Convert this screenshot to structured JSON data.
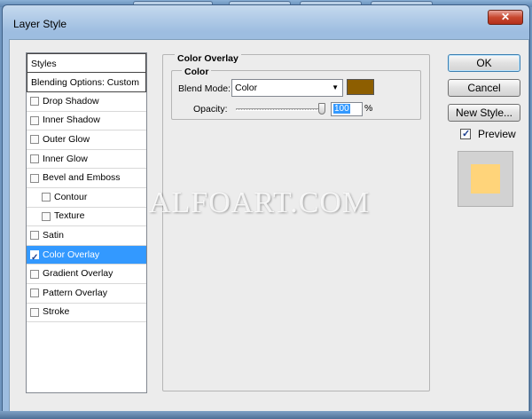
{
  "window": {
    "title": "Layer Style",
    "close_label": "✕"
  },
  "styles_panel": {
    "header": "Styles",
    "blending": "Blending Options: Custom",
    "items": [
      {
        "label": "Drop Shadow",
        "checked": false,
        "indent": false,
        "selected": false
      },
      {
        "label": "Inner Shadow",
        "checked": false,
        "indent": false,
        "selected": false
      },
      {
        "label": "Outer Glow",
        "checked": false,
        "indent": false,
        "selected": false
      },
      {
        "label": "Inner Glow",
        "checked": false,
        "indent": false,
        "selected": false
      },
      {
        "label": "Bevel and Emboss",
        "checked": false,
        "indent": false,
        "selected": false
      },
      {
        "label": "Contour",
        "checked": false,
        "indent": true,
        "selected": false
      },
      {
        "label": "Texture",
        "checked": false,
        "indent": true,
        "selected": false
      },
      {
        "label": "Satin",
        "checked": false,
        "indent": false,
        "selected": false
      },
      {
        "label": "Color Overlay",
        "checked": true,
        "indent": false,
        "selected": true
      },
      {
        "label": "Gradient Overlay",
        "checked": false,
        "indent": false,
        "selected": false
      },
      {
        "label": "Pattern Overlay",
        "checked": false,
        "indent": false,
        "selected": false
      },
      {
        "label": "Stroke",
        "checked": false,
        "indent": false,
        "selected": false
      }
    ]
  },
  "color_overlay": {
    "group_title": "Color Overlay",
    "sub_title": "Color",
    "blend_label": "Blend Mode:",
    "blend_value": "Color",
    "swatch_color": "#8d5e00",
    "opacity_label": "Opacity:",
    "opacity_value": "100",
    "opacity_unit": "%"
  },
  "buttons": {
    "ok": "OK",
    "cancel": "Cancel",
    "new_style": "New Style..."
  },
  "preview": {
    "label": "Preview",
    "checked": true,
    "fill_color": "#ffd47a"
  },
  "watermark": "ALFOART.COM"
}
